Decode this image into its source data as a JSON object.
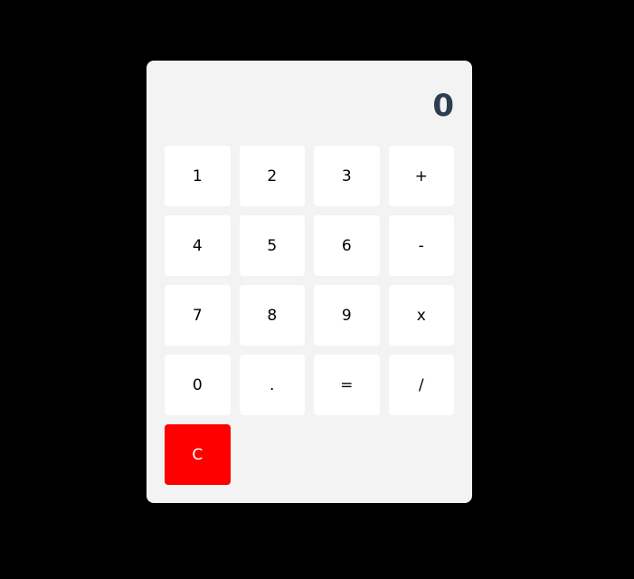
{
  "display": {
    "value": "0"
  },
  "keys": [
    {
      "label": "1",
      "name": "key-1"
    },
    {
      "label": "2",
      "name": "key-2"
    },
    {
      "label": "3",
      "name": "key-3"
    },
    {
      "label": "+",
      "name": "key-plus"
    },
    {
      "label": "4",
      "name": "key-4"
    },
    {
      "label": "5",
      "name": "key-5"
    },
    {
      "label": "6",
      "name": "key-6"
    },
    {
      "label": "-",
      "name": "key-minus"
    },
    {
      "label": "7",
      "name": "key-7"
    },
    {
      "label": "8",
      "name": "key-8"
    },
    {
      "label": "9",
      "name": "key-9"
    },
    {
      "label": "x",
      "name": "key-multiply"
    },
    {
      "label": "0",
      "name": "key-0"
    },
    {
      "label": ".",
      "name": "key-decimal"
    },
    {
      "label": "=",
      "name": "key-equals"
    },
    {
      "label": "/",
      "name": "key-divide"
    },
    {
      "label": "C",
      "name": "key-clear"
    }
  ],
  "colors": {
    "page_background": "#000000",
    "panel_background": "#f3f3f3",
    "key_background": "#ffffff",
    "clear_key_background": "#ff0000",
    "display_text": "#2c3e50"
  }
}
